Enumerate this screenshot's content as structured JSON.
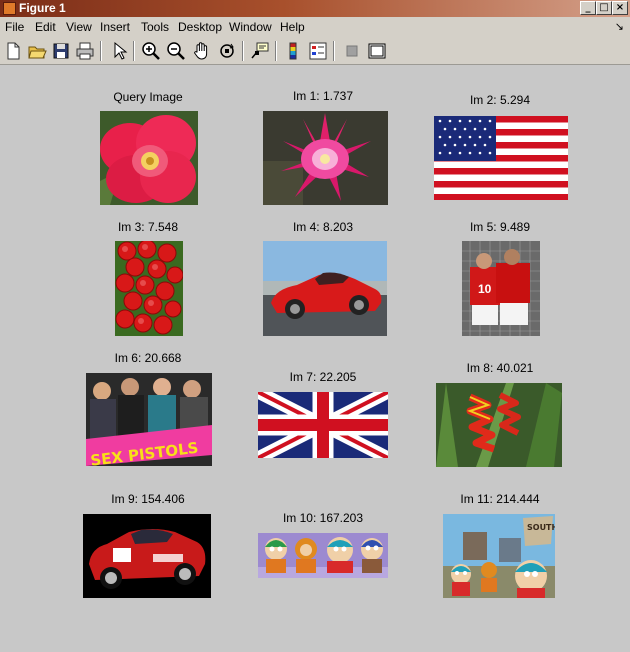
{
  "window": {
    "title": "Figure 1",
    "controls": [
      "_",
      "□",
      "×"
    ]
  },
  "menu": {
    "items": [
      "File",
      "Edit",
      "View",
      "Insert",
      "Tools",
      "Desktop",
      "Window",
      "Help"
    ],
    "dock_arrow": "↘"
  },
  "toolbar": {
    "buttons": [
      "new-figure",
      "open-file",
      "save-figure",
      "print-figure",
      "edit-plot",
      "zoom-in",
      "zoom-out",
      "pan",
      "rotate-3d",
      "data-cursor",
      "insert-colorbar",
      "insert-legend",
      "hide-plot-tools",
      "show-plot-tools"
    ]
  },
  "figure": {
    "captions": {
      "query": "Query Image",
      "im1": "Im 1: 1.737",
      "im2": "Im 2: 5.294",
      "im3": "Im 3: 7.548",
      "im4": "Im 4: 8.203",
      "im5": "Im 5: 9.489",
      "im6": "Im 6: 20.668",
      "im7": "Im 7: 22.205",
      "im8": "Im 8: 40.021",
      "im9": "Im 9: 154.406",
      "im10": "Im 10: 167.203",
      "im11": "Im 11: 214.444"
    },
    "banner_text": "SEX PISTOLS",
    "sign_text": "SOUTH PARK"
  }
}
